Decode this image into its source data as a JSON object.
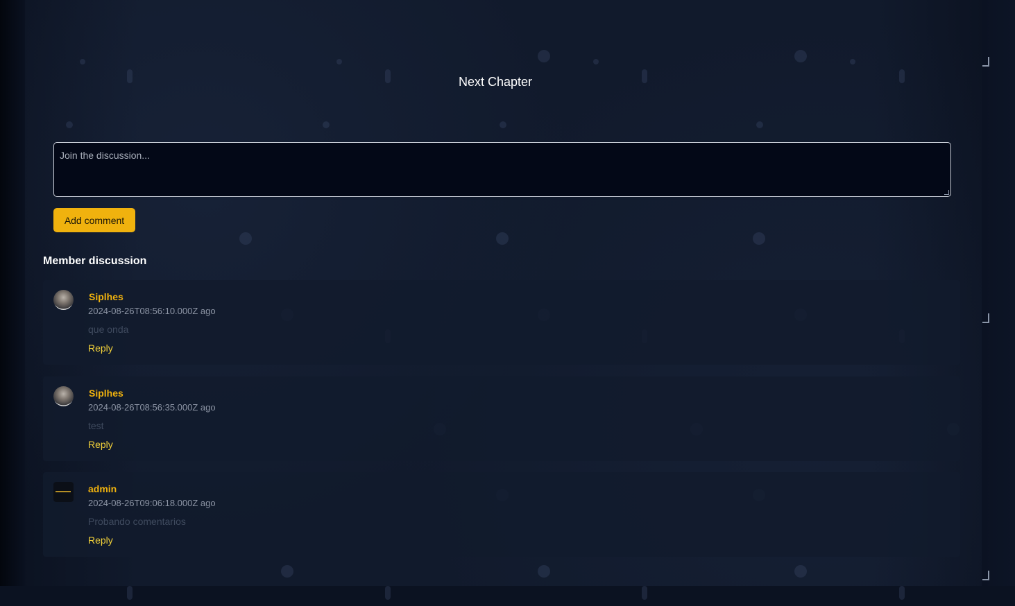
{
  "nav": {
    "next_chapter": "Next Chapter"
  },
  "comment_form": {
    "placeholder": "Join the discussion...",
    "submit_label": "Add comment"
  },
  "discussion": {
    "title": "Member discussion",
    "comments": [
      {
        "author": "Siplhes",
        "date": "2024-08-26T08:56:10.000Z ago",
        "text": "que onda",
        "reply": "Reply"
      },
      {
        "author": "Siplhes",
        "date": "2024-08-26T08:56:35.000Z ago",
        "text": "test",
        "reply": "Reply"
      },
      {
        "author": "admin",
        "date": "2024-08-26T09:06:18.000Z ago",
        "text": "Probando comentarios",
        "reply": "Reply"
      }
    ]
  },
  "colors": {
    "accent": "#f0b20e",
    "reply": "#f3d23a",
    "background": "#111a2c"
  }
}
